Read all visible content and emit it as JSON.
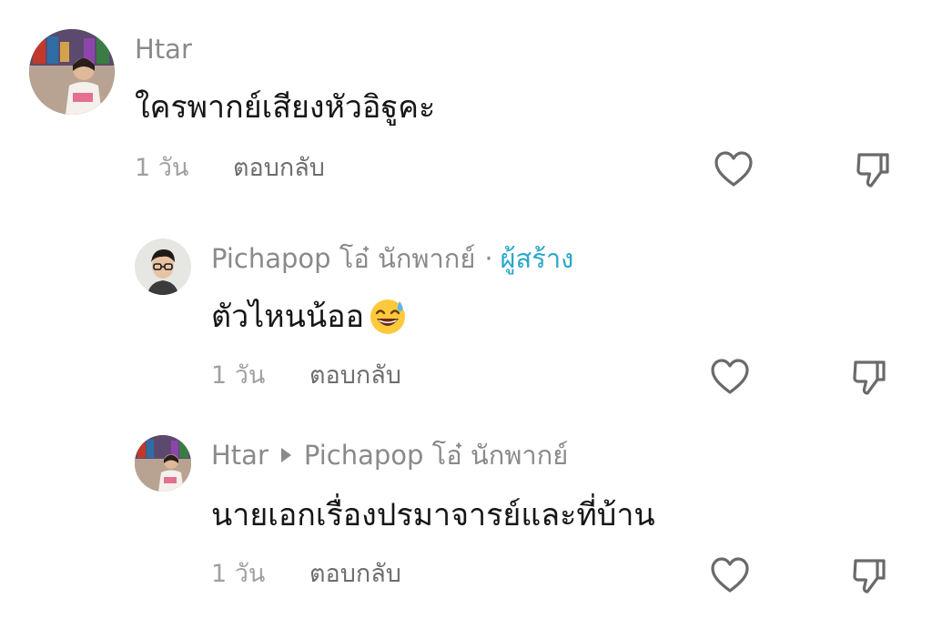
{
  "comments": [
    {
      "username": "Htar",
      "text": "ใครพากย์เสียงหัวอิฐูคะ",
      "time": "1 วัน",
      "reply_label": "ตอบกลับ"
    },
    {
      "username": "Pichapop โอ๋ นักพากย์",
      "separator": "·",
      "creator_badge": "ผู้สร้าง",
      "text": "ตัวไหนน้ออ",
      "emoji": "sweat-smile-emoji",
      "time": "1 วัน",
      "reply_label": "ตอบกลับ"
    },
    {
      "username": "Htar",
      "reply_to": "Pichapop โอ๋ นักพากย์",
      "text": "นายเอกเรื่องปรมาจารย์และที่บ้าน",
      "time": "1 วัน",
      "reply_label": "ตอบกลับ"
    }
  ],
  "icons": {
    "like": "heart-outline-icon",
    "dislike": "thumbs-down-outline-icon"
  },
  "colors": {
    "creator": "#2aa7c9",
    "username": "#8a8a8a",
    "text": "#161616",
    "time": "#a0a0a0"
  }
}
